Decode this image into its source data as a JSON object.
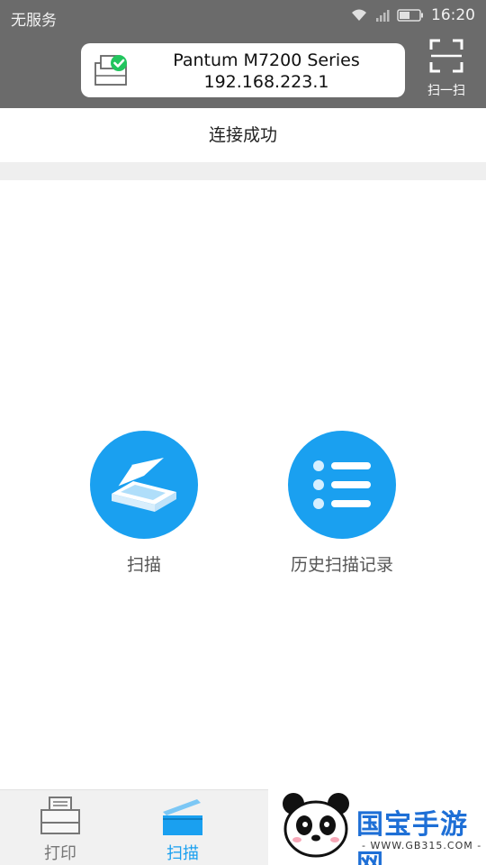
{
  "status_bar": {
    "carrier": "无服务",
    "time": "16:20"
  },
  "header": {
    "device_name": "Pantum M7200 Series",
    "device_ip": "192.168.223.1",
    "scan_qr_label": "扫一扫"
  },
  "connection_status": "连接成功",
  "actions": {
    "scan_label": "扫描",
    "history_label": "历史扫描记录"
  },
  "bottom_nav": {
    "print_label": "打印",
    "scan_label": "扫描",
    "active": "扫描"
  },
  "watermark": {
    "brand": "国宝手游网",
    "url": "- WWW.GB315.COM -"
  },
  "colors": {
    "header_bg": "#6b6b6b",
    "accent": "#1aa0f0",
    "success": "#22c55e"
  }
}
